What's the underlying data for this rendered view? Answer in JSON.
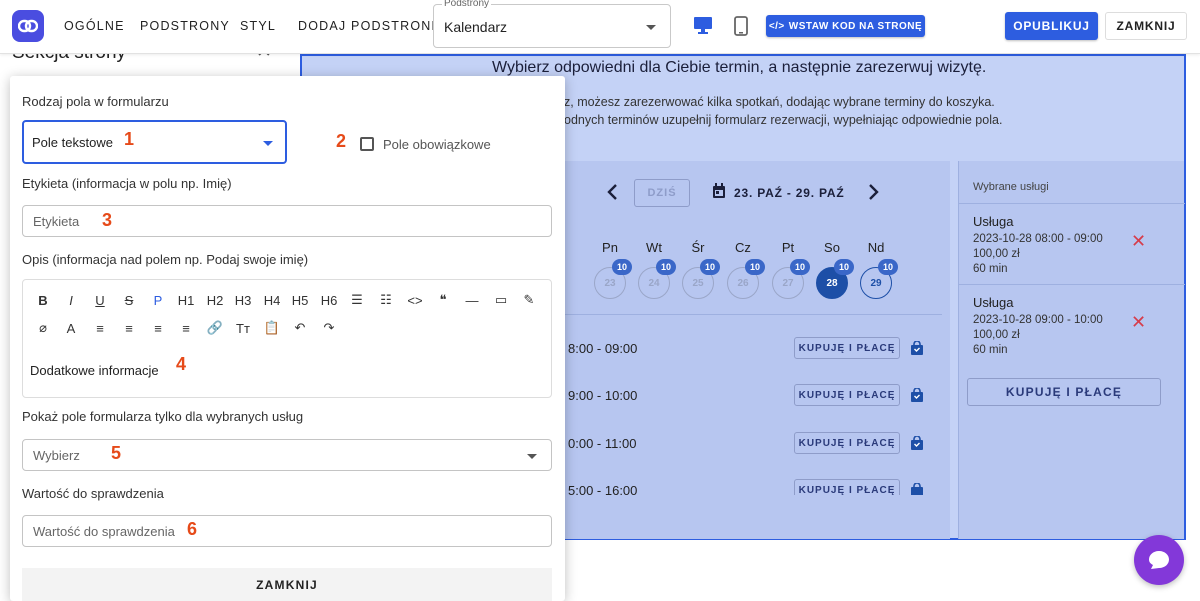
{
  "topbar": {
    "nav": [
      "OGÓLNE",
      "PODSTRONY",
      "STYL",
      "DODAJ PODSTRONĘ"
    ],
    "subpage_label": "Podstrony",
    "subpage_value": "Kalendarz",
    "embed_label": "WSTAW KOD NA STRONĘ",
    "publish_label": "OPUBLIKUJ",
    "close_label": "ZAMKNIJ"
  },
  "section": {
    "title": "Sekcja strony"
  },
  "preview": {
    "title": "Wybierz odpowiedni dla Ciebie termin, a następnie zarezerwuj wizytę.",
    "desc1": "z, możesz zarezerwować kilka spotkań, dodając wybrane terminy do koszyka.",
    "desc2": "odnych terminów uzupełnij formularz rezerwacji, wypełniając odpowiednie pola.",
    "today_label": "DZIŚ",
    "date_range": "23. PAŹ - 29. PAŹ",
    "weekdays": [
      "Pn",
      "Wt",
      "Śr",
      "Cz",
      "Pt",
      "So",
      "Nd"
    ],
    "days": [
      "23",
      "24",
      "25",
      "26",
      "27",
      "28",
      "29"
    ],
    "badge": "10",
    "slots": [
      "8:00 - 09:00",
      "9:00 - 10:00",
      "0:00 - 11:00",
      "5:00 - 16:00"
    ],
    "slot_btn": "KUPUJĘ I PŁACĘ",
    "cart_head": "Wybrane usługi",
    "cart_items": [
      {
        "title": "Usługa",
        "datetime": "2023-10-28 08:00 - 09:00",
        "price": "100,00 zł",
        "duration": "60 min"
      },
      {
        "title": "Usługa",
        "datetime": "2023-10-28 09:00 - 10:00",
        "price": "100,00 zł",
        "duration": "60 min"
      }
    ],
    "cart_btn": "KUPUJĘ I PŁACĘ"
  },
  "form": {
    "field_type_label": "Rodzaj pola w formularzu",
    "field_type_value": "Pole tekstowe",
    "required_label": "Pole obowiązkowe",
    "tag_label": "Etykieta (informacja w polu np. Imię)",
    "tag_placeholder": "Etykieta",
    "desc_label": "Opis (informacja nad polem np. Podaj swoje imię)",
    "toolbar_row1": [
      "B",
      "I",
      "U",
      "S",
      "P",
      "H1",
      "H2",
      "H3",
      "H4",
      "H5",
      "H6",
      "☰",
      "☷",
      "<>",
      "❝",
      "—",
      "▭",
      "✎"
    ],
    "toolbar_row2": [
      "⌀",
      "A",
      "≡",
      "≡",
      "≡",
      "≡",
      "🔗",
      "Tт",
      "📋",
      "↶",
      "↷"
    ],
    "editor_text": "Dodatkowe informacje",
    "services_label": "Pokaż pole formularza tylko dla wybranych usług",
    "services_placeholder": "Wybierz",
    "check_label": "Wartość do sprawdzenia",
    "check_placeholder": "Wartość do sprawdzenia",
    "close_label": "ZAMKNIJ",
    "markers": [
      "1",
      "2",
      "3",
      "4",
      "5",
      "6"
    ]
  }
}
